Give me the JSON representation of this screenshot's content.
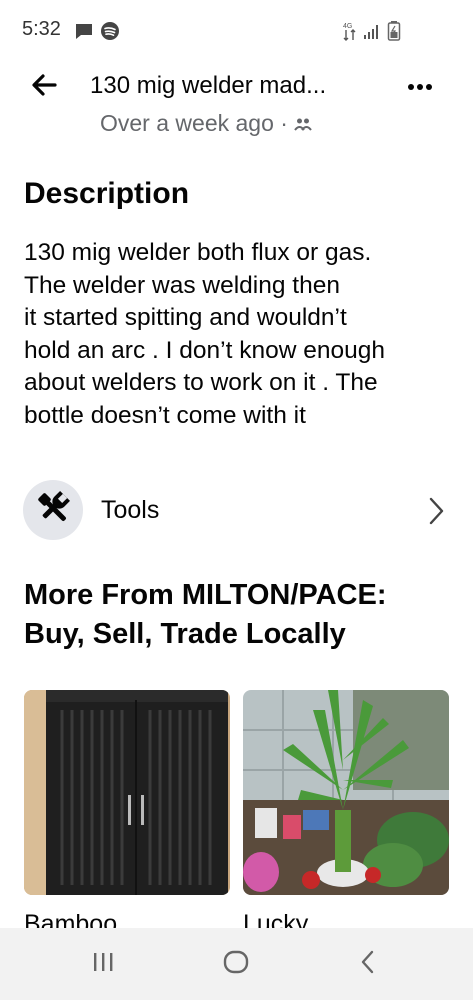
{
  "status_bar": {
    "time": "5:32",
    "left_icons": [
      "message-icon",
      "spotify-icon"
    ],
    "right_icons": [
      "data-arrows-icon",
      "signal-icon",
      "battery-icon"
    ]
  },
  "header": {
    "title": "130 mig welder mad...",
    "back_icon": "back-arrow-icon",
    "more_icon": "more-dots-icon"
  },
  "posted": {
    "text": "Over a week ago ·",
    "icon": "friends-icon"
  },
  "description": {
    "heading": "Description",
    "body": "130 mig welder both flux or gas.\nThe welder was welding then\nit started spitting and wouldn’t\nhold an arc . I don’t know enough\nabout welders to work on it . The\nbottle doesn’t come with it"
  },
  "category": {
    "label": "Tools",
    "icon": "tools-icon"
  },
  "more_from": {
    "heading": "More From MILTON/PACE: Buy, Sell, Trade Locally",
    "listings": [
      {
        "title": "Bamboo",
        "image": "black-cabinet-photo"
      },
      {
        "title": "Lucky",
        "image": "bamboo-plant-photo"
      }
    ]
  },
  "nav_bar": {
    "buttons": [
      "recent-apps-icon",
      "home-icon",
      "back-icon"
    ]
  },
  "colors": {
    "text": "#050505",
    "secondary_text": "#65676b",
    "icon_circle": "#e4e6eb",
    "nav_bg": "#f2f2f2"
  }
}
